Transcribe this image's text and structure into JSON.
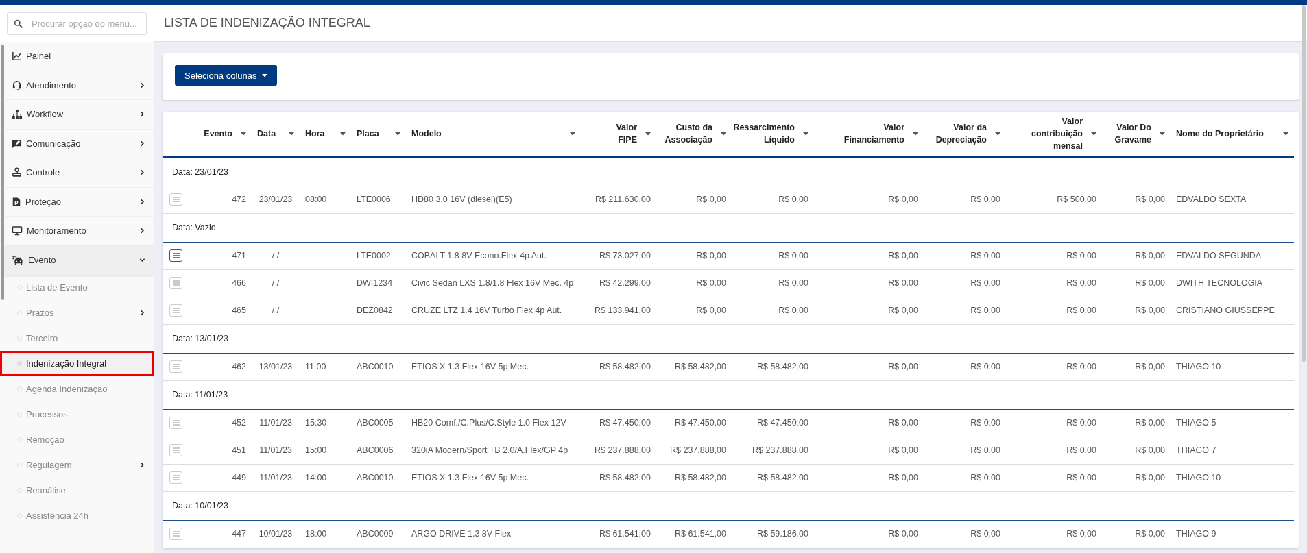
{
  "search": {
    "placeholder": "Procurar opção do menu..."
  },
  "sidebar": {
    "items": [
      {
        "label": "Painel",
        "expandable": false,
        "expanded": false
      },
      {
        "label": "Atendimento",
        "expandable": true,
        "expanded": false
      },
      {
        "label": "Workflow",
        "expandable": true,
        "expanded": false
      },
      {
        "label": "Comunicação",
        "expandable": true,
        "expanded": false
      },
      {
        "label": "Controle",
        "expandable": true,
        "expanded": false
      },
      {
        "label": "Proteção",
        "expandable": true,
        "expanded": false
      },
      {
        "label": "Monitoramento",
        "expandable": true,
        "expanded": false
      },
      {
        "label": "Evento",
        "expandable": true,
        "expanded": true,
        "children": [
          {
            "label": "Lista de Evento",
            "expandable": false,
            "selected": false,
            "annotated": false
          },
          {
            "label": "Prazos",
            "expandable": true,
            "selected": false,
            "annotated": false
          },
          {
            "label": "Terceiro",
            "expandable": false,
            "selected": false,
            "annotated": false
          },
          {
            "label": "Indenização Integral",
            "expandable": false,
            "selected": true,
            "annotated": true
          },
          {
            "label": "Agenda Indenização",
            "expandable": false,
            "selected": false,
            "annotated": false
          },
          {
            "label": "Processos",
            "expandable": false,
            "selected": false,
            "annotated": false
          },
          {
            "label": "Remoção",
            "expandable": false,
            "selected": false,
            "annotated": false
          },
          {
            "label": "Regulagem",
            "expandable": true,
            "selected": false,
            "annotated": false
          },
          {
            "label": "Reanálise",
            "expandable": false,
            "selected": false,
            "annotated": false
          },
          {
            "label": "Assistência 24h",
            "expandable": false,
            "selected": false,
            "annotated": false
          }
        ]
      }
    ]
  },
  "page": {
    "title": "LISTA DE INDENIZAÇÃO INTEGRAL"
  },
  "toolbar": {
    "button": "Seleciona colunas"
  },
  "table": {
    "columns": [
      {
        "label": "Evento",
        "kind": "number"
      },
      {
        "label": "Data",
        "kind": "text"
      },
      {
        "label": "Hora",
        "kind": "text"
      },
      {
        "label": "Placa",
        "kind": "text"
      },
      {
        "label": "Modelo",
        "kind": "text"
      },
      {
        "label": "Valor\nFIPE",
        "kind": "number"
      },
      {
        "label": "Custo da\nAssociação",
        "kind": "number"
      },
      {
        "label": "Ressarcimento\nLíquido",
        "kind": "number"
      },
      {
        "label": "Valor\nFinanciamento",
        "kind": "number"
      },
      {
        "label": "Valor da\nDepreciação",
        "kind": "number"
      },
      {
        "label": "Valor\ncontribuição\nmensal",
        "kind": "number"
      },
      {
        "label": "Valor Do\nGravame",
        "kind": "number"
      },
      {
        "label": "Nome do Proprietário",
        "kind": "text"
      }
    ],
    "groups": [
      {
        "label": "Data: 23/01/23",
        "rows": [
          {
            "active": false,
            "cells": [
              "472",
              "23/01/23",
              "08:00",
              "LTE0006",
              "HD80 3.0 16V (diesel)(E5)",
              "R$ 211.630,00",
              "R$ 0,00",
              "R$ 0,00",
              "R$ 0,00",
              "R$ 0,00",
              "R$ 500,00",
              "R$ 0,00",
              "EDVALDO SEXTA"
            ]
          }
        ]
      },
      {
        "label": "Data: Vazio",
        "rows": [
          {
            "active": true,
            "cells": [
              "471",
              "/ /",
              null,
              "LTE0002",
              "COBALT 1.8 8V Econo.Flex 4p Aut.",
              "R$ 73.027,00",
              "R$ 0,00",
              "R$ 0,00",
              "R$ 0,00",
              "R$ 0,00",
              "R$ 0,00",
              "R$ 0,00",
              "EDVALDO SEGUNDA"
            ]
          },
          {
            "active": false,
            "cells": [
              "466",
              "/ /",
              null,
              "DWI1234",
              "Civic Sedan LXS 1.8/1.8 Flex 16V Mec. 4p",
              "R$ 42.299,00",
              "R$ 0,00",
              "R$ 0,00",
              "R$ 0,00",
              "R$ 0,00",
              "R$ 0,00",
              "R$ 0,00",
              "DWITH TECNOLOGIA"
            ]
          },
          {
            "active": false,
            "cells": [
              "465",
              "/ /",
              null,
              "DEZ0842",
              "CRUZE LTZ 1.4 16V Turbo Flex 4p Aut.",
              "R$ 133.941,00",
              "R$ 0,00",
              "R$ 0,00",
              "R$ 0,00",
              "R$ 0,00",
              "R$ 0,00",
              "R$ 0,00",
              "CRISTIANO GIUSSEPPE"
            ]
          }
        ]
      },
      {
        "label": "Data: 13/01/23",
        "rows": [
          {
            "active": false,
            "cells": [
              "462",
              "13/01/23",
              "11:00",
              "ABC0010",
              "ETIOS X 1.3 Flex 16V 5p Mec.",
              "R$ 58.482,00",
              "R$ 58.482,00",
              "R$ 58.482,00",
              "R$ 0,00",
              "R$ 0,00",
              "R$ 0,00",
              "R$ 0,00",
              "THIAGO 10"
            ]
          }
        ]
      },
      {
        "label": "Data: 11/01/23",
        "rows": [
          {
            "active": false,
            "cells": [
              "452",
              "11/01/23",
              "15:30",
              "ABC0005",
              "HB20 Comf./C.Plus/C.Style 1.0 Flex 12V",
              "R$ 47.450,00",
              "R$ 47.450,00",
              "R$ 47.450,00",
              "R$ 0,00",
              "R$ 0,00",
              "R$ 0,00",
              "R$ 0,00",
              "THIAGO 5"
            ]
          },
          {
            "active": false,
            "cells": [
              "451",
              "11/01/23",
              "15:00",
              "ABC0006",
              "320iA Modern/Sport TB 2.0/A.Flex/GP 4p",
              "R$ 237.888,00",
              "R$ 237.888,00",
              "R$ 237.888,00",
              "R$ 0,00",
              "R$ 0,00",
              "R$ 0,00",
              "R$ 0,00",
              "THIAGO 7"
            ]
          },
          {
            "active": false,
            "cells": [
              "449",
              "11/01/23",
              "14:00",
              "ABC0010",
              "ETIOS X 1.3 Flex 16V 5p Mec.",
              "R$ 58.482,00",
              "R$ 58.482,00",
              "R$ 58.482,00",
              "R$ 0,00",
              "R$ 0,00",
              "R$ 0,00",
              "R$ 0,00",
              "THIAGO 10"
            ]
          }
        ]
      },
      {
        "label": "Data: 10/01/23",
        "rows": [
          {
            "active": false,
            "cells": [
              "447",
              "10/01/23",
              "18:00",
              "ABC0009",
              "ARGO DRIVE 1.3 8V Flex",
              "R$ 61.541,00",
              "R$ 61.541,00",
              "R$ 59.186,00",
              "R$ 0,00",
              "R$ 0,00",
              "R$ 0,00",
              "R$ 0,00",
              "THIAGO 9"
            ]
          }
        ]
      }
    ]
  }
}
